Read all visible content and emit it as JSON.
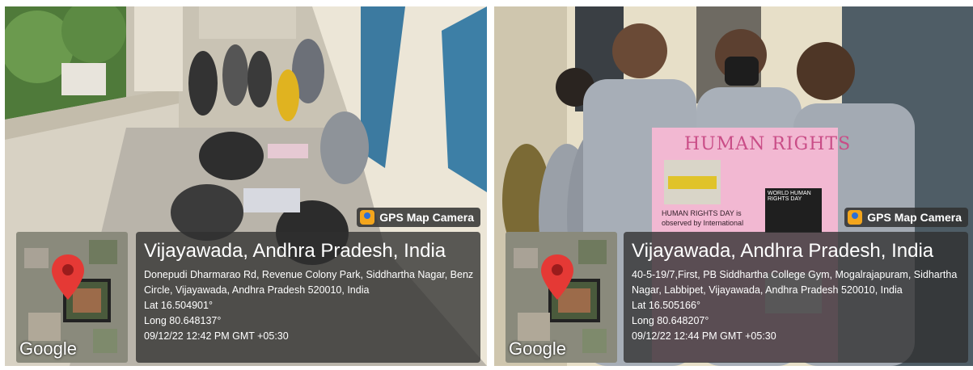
{
  "left": {
    "badge_label": "GPS Map Camera",
    "badge_icon": "gps-camera-icon",
    "location_title": "Vijayawada, Andhra Pradesh, India",
    "address": "Donepudi Dharmarao Rd, Revenue Colony Park, Siddhartha Nagar, Benz Circle, Vijayawada, Andhra Pradesh 520010, India",
    "lat": "Lat 16.504901°",
    "long": "Long 80.648137°",
    "datetime": "09/12/22 12:42 PM GMT +05:30",
    "map_watermark": "Google"
  },
  "right": {
    "badge_label": "GPS Map Camera",
    "badge_icon": "gps-camera-icon",
    "location_title": "Vijayawada, Andhra Pradesh, India",
    "address": "40-5-19/7,First, PB Siddhartha College Gym, Mogalrajapuram, Sidhartha Nagar, Labbipet, Vijayawada, Andhra Pradesh 520010, India",
    "lat": "Lat 16.505166°",
    "long": "Long 80.648207°",
    "datetime": "09/12/22 12:44 PM GMT +05:30",
    "map_watermark": "Google",
    "poster_title": "HUMAN RIGHTS",
    "poster_text": "HUMAN RIGHTS DAY is observed by International",
    "poster_sign": "WORLD HUMAN RIGHTS DAY"
  },
  "colors": {
    "pin": "#e53935",
    "badge_icon": "#f3a51c",
    "overlay": "#303030",
    "poster_pink": "#f2b8d2"
  }
}
